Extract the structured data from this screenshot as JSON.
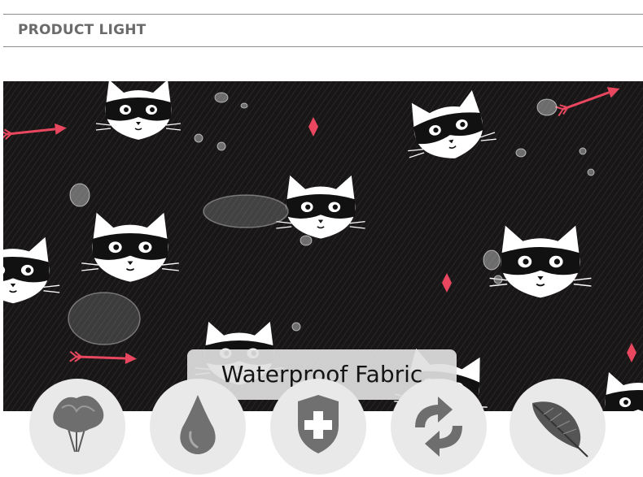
{
  "header": {
    "section_title": "PRODUCT LIGHT"
  },
  "banner": {
    "caption": "Waterproof Fabric"
  },
  "features": [
    {
      "icon": "feather-duster-icon"
    },
    {
      "icon": "water-drop-icon"
    },
    {
      "icon": "shield-cross-icon"
    },
    {
      "icon": "recycle-arrows-icon"
    },
    {
      "icon": "feather-icon"
    }
  ],
  "colors": {
    "fabric": "#181616",
    "accent_pink": "#e8475f",
    "caption_bg": "#e0e0e0",
    "title_gray": "#6b6b6b"
  }
}
